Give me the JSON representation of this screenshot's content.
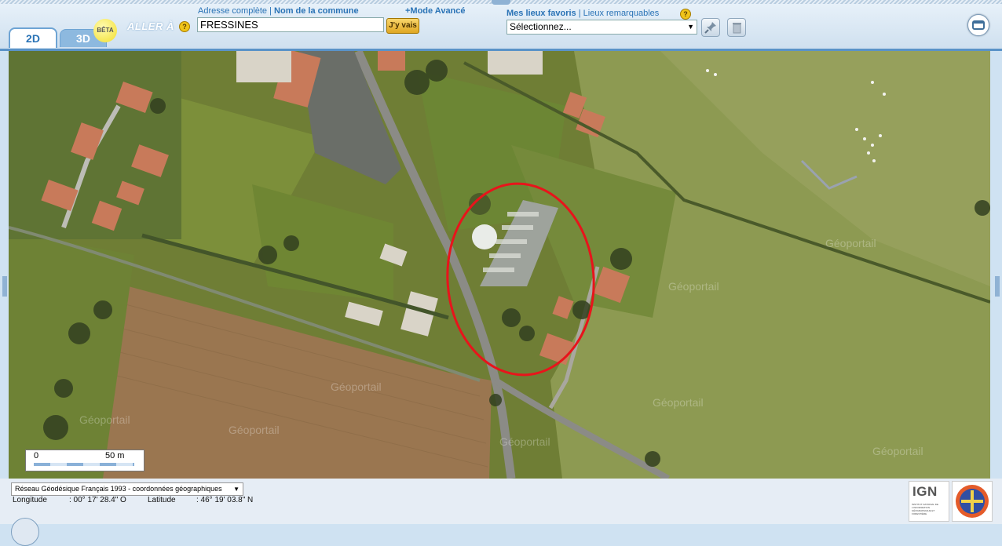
{
  "tabs": [
    {
      "label": "2D",
      "active": true
    },
    {
      "label": "3D",
      "active": false
    }
  ],
  "beta_badge": "BÊTA",
  "goto": {
    "label": "ALLER À",
    "help": "?",
    "address_link": "Adresse complète",
    "separator": "|",
    "commune_link": "Nom de la commune",
    "advanced_link": "+Mode Avancé",
    "search_value": "FRESSINES",
    "go_button": "J'y vais"
  },
  "favorites": {
    "label": "Mes lieux favoris",
    "separator": "|",
    "remarkable_link": "Lieux remarquables",
    "help": "?",
    "select_value": "Sélectionnez..."
  },
  "map": {
    "watermark": "Géoportail",
    "scale": {
      "start": "0",
      "end": "50 m"
    }
  },
  "footer": {
    "crs_select": "Réseau Géodésique Français 1993 - coordonnées géographiques",
    "longitude_label": "Longitude",
    "longitude_value": ": 00° 17' 28.4\" O",
    "latitude_label": "Latitude",
    "latitude_value": ": 46° 19' 03.8\" N",
    "ign_logo": "IGN",
    "ign_subtitle": "INSTITUT NATIONAL DE L'INFORMATION GÉOGRAPHIQUE ET FORESTIÈRE"
  },
  "colors": {
    "brand_blue": "#2a73b6",
    "annotation_circle": "#e8141b",
    "go_button": "#e0a723"
  }
}
